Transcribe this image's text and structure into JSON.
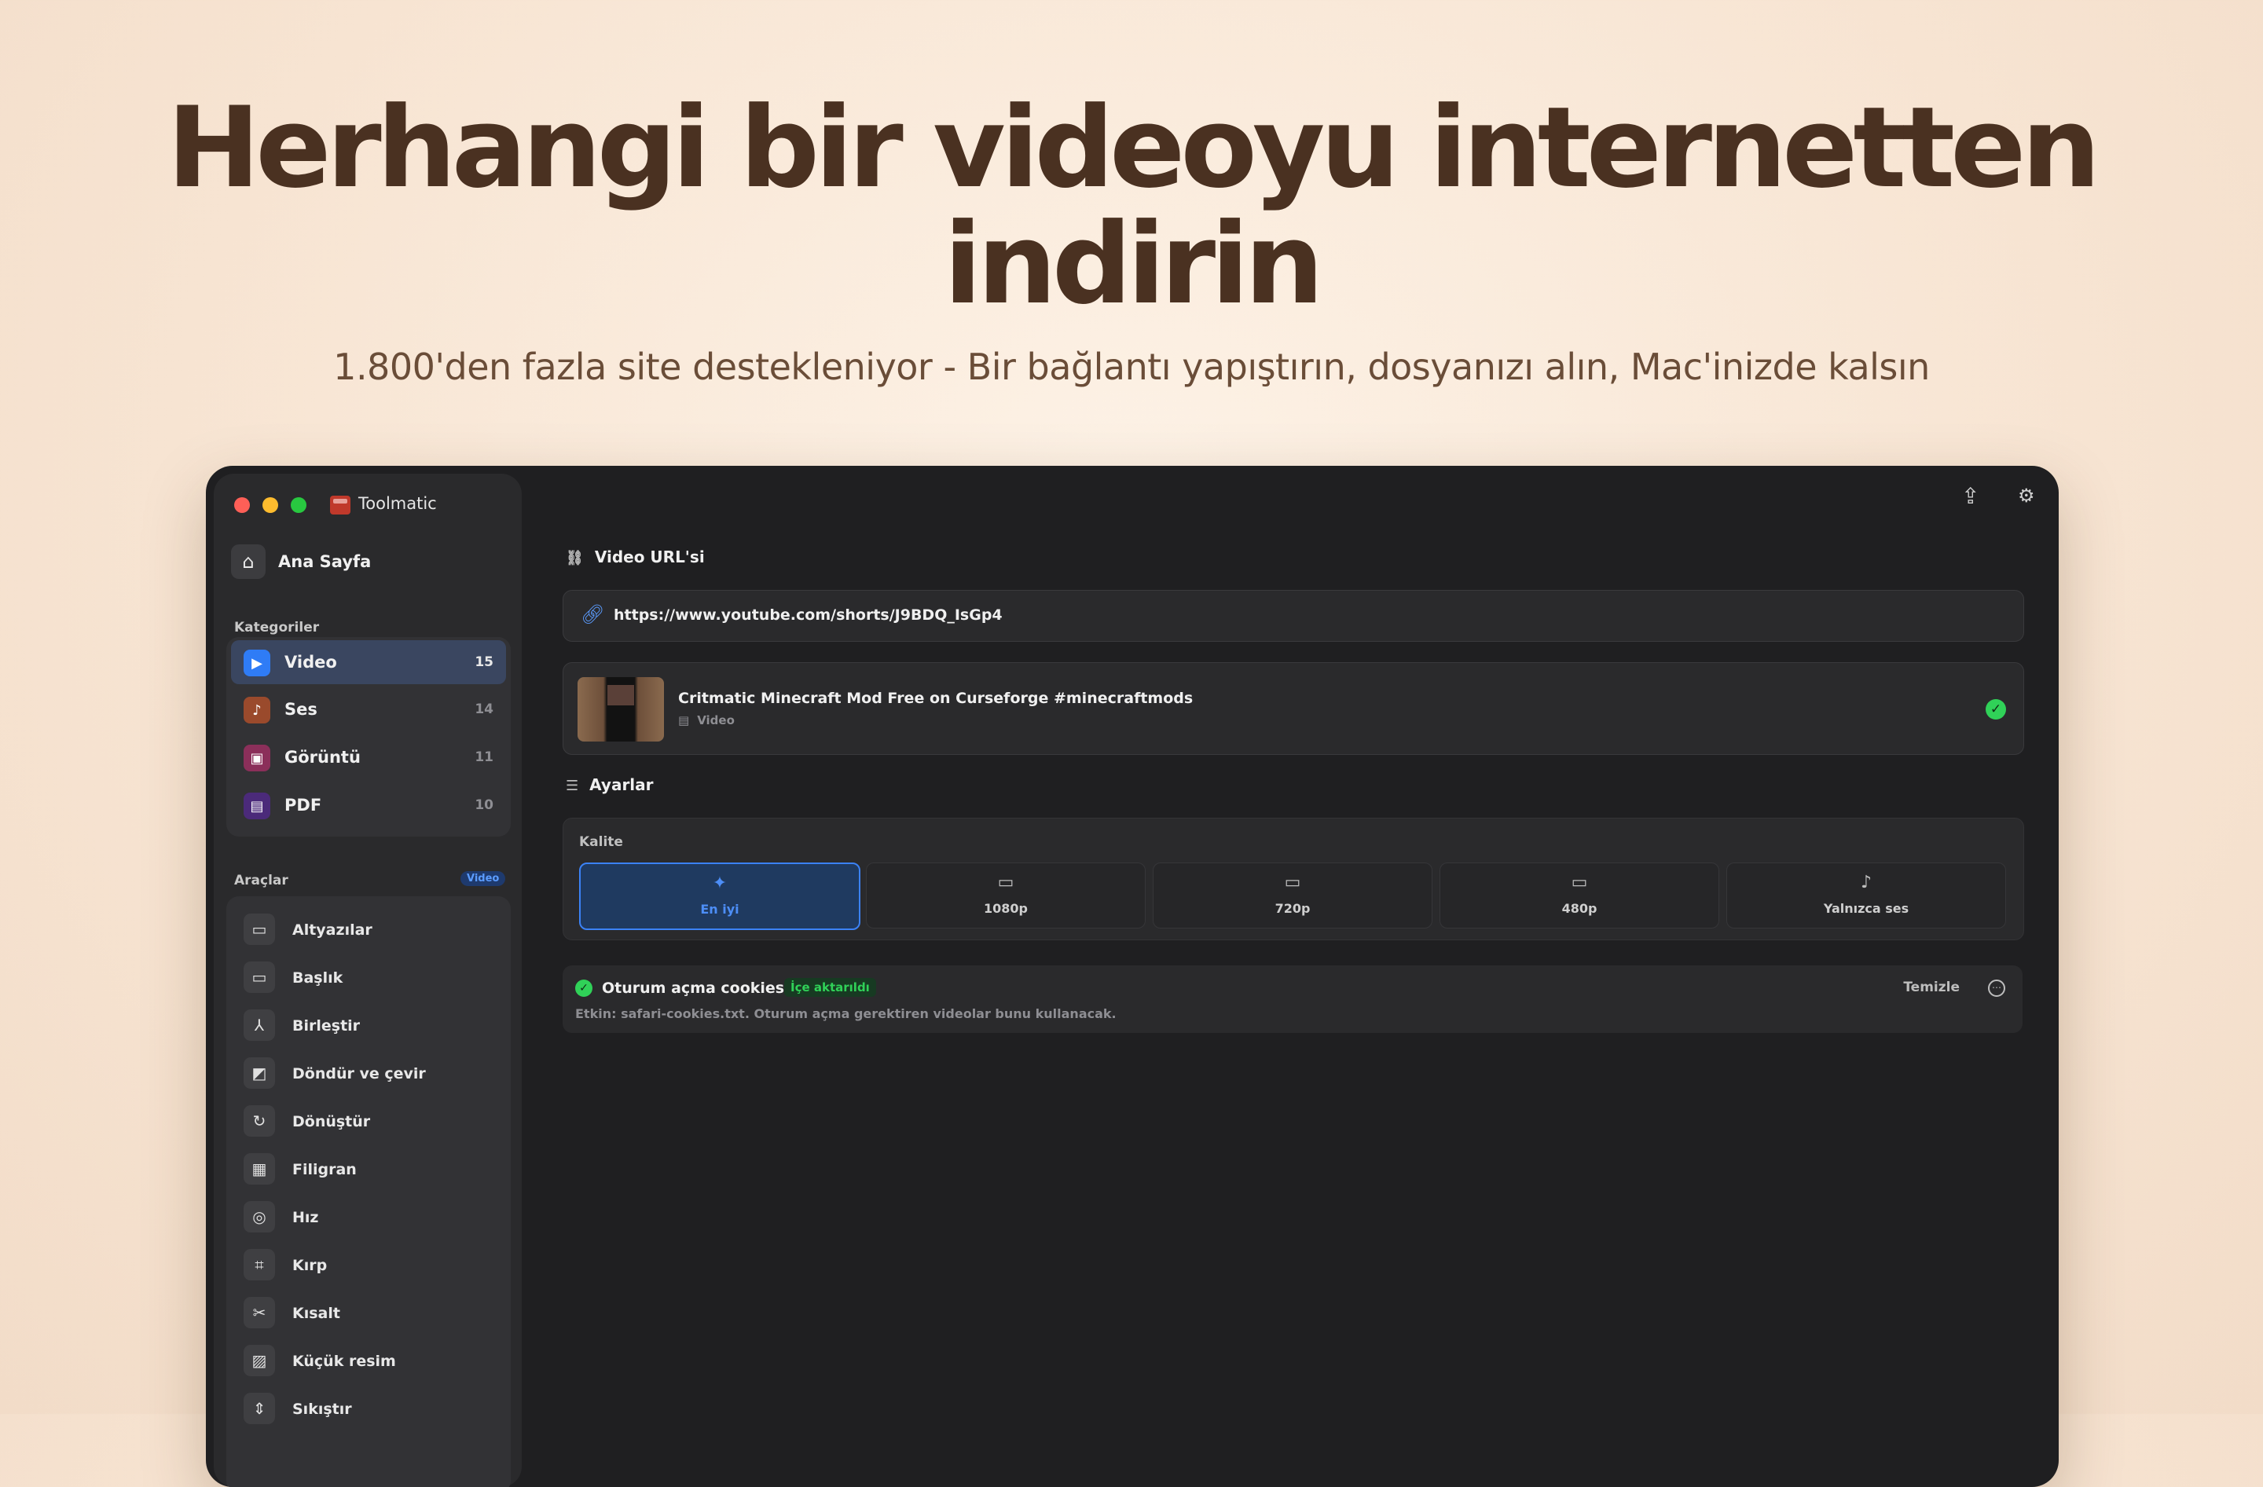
{
  "hero": {
    "title_line1": "Herhangi bir videoyu internetten",
    "title_line2": "indirin",
    "subtitle": "1.800'den fazla site destekleniyor - Bir bağlantı yapıştırın, dosyanızı alın, Mac'inizde kalsın"
  },
  "app": {
    "title": "Toolmatic"
  },
  "sidebar": {
    "home_label": "Ana Sayfa",
    "home_icon": "⌂",
    "categories_heading": "Kategoriler",
    "categories": [
      {
        "label": "Video",
        "count": "15",
        "icon": "▶",
        "color": "#2f7cf6"
      },
      {
        "label": "Ses",
        "count": "14",
        "icon": "♪",
        "color": "#9a4a2c"
      },
      {
        "label": "Görüntü",
        "count": "11",
        "icon": "▣",
        "color": "#8b2f5a"
      },
      {
        "label": "PDF",
        "count": "10",
        "icon": "▤",
        "color": "#4b2a7a"
      }
    ],
    "tools_heading": "Araçlar",
    "tools_badge": "Video",
    "tools": [
      {
        "label": "Altyazılar",
        "icon": "▭"
      },
      {
        "label": "Başlık",
        "icon": "▭"
      },
      {
        "label": "Birleştir",
        "icon": "⅄"
      },
      {
        "label": "Döndür ve çevir",
        "icon": "◩"
      },
      {
        "label": "Dönüştür",
        "icon": "↻"
      },
      {
        "label": "Filigran",
        "icon": "▦"
      },
      {
        "label": "Hız",
        "icon": "◎"
      },
      {
        "label": "Kırp",
        "icon": "⌗"
      },
      {
        "label": "Kısalt",
        "icon": "✂"
      },
      {
        "label": "Küçük resim",
        "icon": "▨"
      },
      {
        "label": "Sıkıştır",
        "icon": "⇕"
      }
    ]
  },
  "toolbar": {
    "share_icon": "⇪",
    "settings_icon": "⚙"
  },
  "main": {
    "url_heading": "Video URL'si",
    "url_value": "https://www.youtube.com/shorts/J9BDQ_IsGp4",
    "video": {
      "title": "Critmatic Minecraft Mod Free on Curseforge #minecraftmods",
      "type": "Video",
      "check": "✓"
    },
    "settings_heading": "Ayarlar",
    "quality_label": "Kalite",
    "quality_options": [
      {
        "label": "En iyi",
        "icon": "✦"
      },
      {
        "label": "1080p",
        "icon": "▭"
      },
      {
        "label": "720p",
        "icon": "▭"
      },
      {
        "label": "480p",
        "icon": "▭"
      },
      {
        "label": "Yalnızca ses",
        "icon": "♪"
      }
    ],
    "cookies": {
      "title": "Oturum açma cookies",
      "badge": "İçe aktarıldı",
      "description": "Etkin: safari-cookies.txt. Oturum açma gerektiren videolar bunu kullanacak.",
      "clear_label": "Temizle",
      "more_icon": "⋯"
    }
  }
}
